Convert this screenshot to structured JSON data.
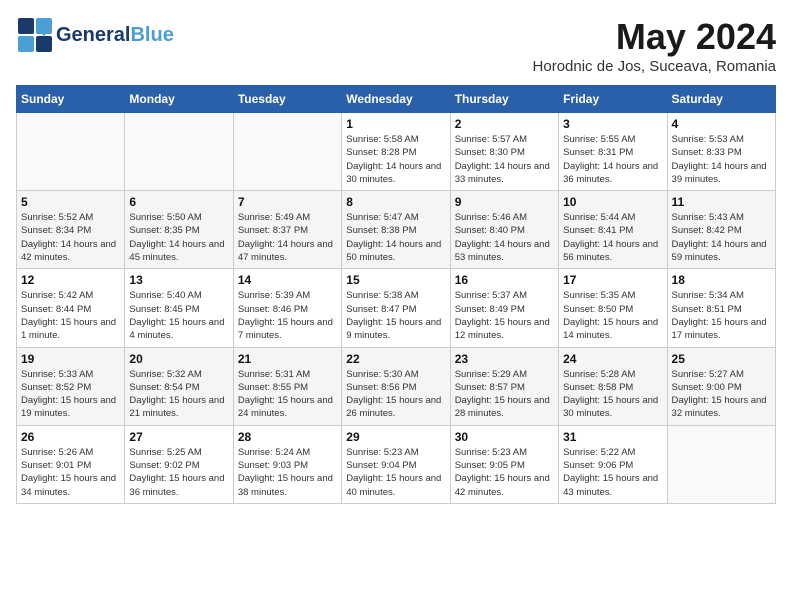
{
  "logo": {
    "part1": "General",
    "part2": "Blue"
  },
  "title": "May 2024",
  "subtitle": "Horodnic de Jos, Suceava, Romania",
  "weekdays": [
    "Sunday",
    "Monday",
    "Tuesday",
    "Wednesday",
    "Thursday",
    "Friday",
    "Saturday"
  ],
  "weeks": [
    [
      {
        "day": "",
        "info": ""
      },
      {
        "day": "",
        "info": ""
      },
      {
        "day": "",
        "info": ""
      },
      {
        "day": "1",
        "info": "Sunrise: 5:58 AM\nSunset: 8:28 PM\nDaylight: 14 hours\nand 30 minutes."
      },
      {
        "day": "2",
        "info": "Sunrise: 5:57 AM\nSunset: 8:30 PM\nDaylight: 14 hours\nand 33 minutes."
      },
      {
        "day": "3",
        "info": "Sunrise: 5:55 AM\nSunset: 8:31 PM\nDaylight: 14 hours\nand 36 minutes."
      },
      {
        "day": "4",
        "info": "Sunrise: 5:53 AM\nSunset: 8:33 PM\nDaylight: 14 hours\nand 39 minutes."
      }
    ],
    [
      {
        "day": "5",
        "info": "Sunrise: 5:52 AM\nSunset: 8:34 PM\nDaylight: 14 hours\nand 42 minutes."
      },
      {
        "day": "6",
        "info": "Sunrise: 5:50 AM\nSunset: 8:35 PM\nDaylight: 14 hours\nand 45 minutes."
      },
      {
        "day": "7",
        "info": "Sunrise: 5:49 AM\nSunset: 8:37 PM\nDaylight: 14 hours\nand 47 minutes."
      },
      {
        "day": "8",
        "info": "Sunrise: 5:47 AM\nSunset: 8:38 PM\nDaylight: 14 hours\nand 50 minutes."
      },
      {
        "day": "9",
        "info": "Sunrise: 5:46 AM\nSunset: 8:40 PM\nDaylight: 14 hours\nand 53 minutes."
      },
      {
        "day": "10",
        "info": "Sunrise: 5:44 AM\nSunset: 8:41 PM\nDaylight: 14 hours\nand 56 minutes."
      },
      {
        "day": "11",
        "info": "Sunrise: 5:43 AM\nSunset: 8:42 PM\nDaylight: 14 hours\nand 59 minutes."
      }
    ],
    [
      {
        "day": "12",
        "info": "Sunrise: 5:42 AM\nSunset: 8:44 PM\nDaylight: 15 hours\nand 1 minute."
      },
      {
        "day": "13",
        "info": "Sunrise: 5:40 AM\nSunset: 8:45 PM\nDaylight: 15 hours\nand 4 minutes."
      },
      {
        "day": "14",
        "info": "Sunrise: 5:39 AM\nSunset: 8:46 PM\nDaylight: 15 hours\nand 7 minutes."
      },
      {
        "day": "15",
        "info": "Sunrise: 5:38 AM\nSunset: 8:47 PM\nDaylight: 15 hours\nand 9 minutes."
      },
      {
        "day": "16",
        "info": "Sunrise: 5:37 AM\nSunset: 8:49 PM\nDaylight: 15 hours\nand 12 minutes."
      },
      {
        "day": "17",
        "info": "Sunrise: 5:35 AM\nSunset: 8:50 PM\nDaylight: 15 hours\nand 14 minutes."
      },
      {
        "day": "18",
        "info": "Sunrise: 5:34 AM\nSunset: 8:51 PM\nDaylight: 15 hours\nand 17 minutes."
      }
    ],
    [
      {
        "day": "19",
        "info": "Sunrise: 5:33 AM\nSunset: 8:52 PM\nDaylight: 15 hours\nand 19 minutes."
      },
      {
        "day": "20",
        "info": "Sunrise: 5:32 AM\nSunset: 8:54 PM\nDaylight: 15 hours\nand 21 minutes."
      },
      {
        "day": "21",
        "info": "Sunrise: 5:31 AM\nSunset: 8:55 PM\nDaylight: 15 hours\nand 24 minutes."
      },
      {
        "day": "22",
        "info": "Sunrise: 5:30 AM\nSunset: 8:56 PM\nDaylight: 15 hours\nand 26 minutes."
      },
      {
        "day": "23",
        "info": "Sunrise: 5:29 AM\nSunset: 8:57 PM\nDaylight: 15 hours\nand 28 minutes."
      },
      {
        "day": "24",
        "info": "Sunrise: 5:28 AM\nSunset: 8:58 PM\nDaylight: 15 hours\nand 30 minutes."
      },
      {
        "day": "25",
        "info": "Sunrise: 5:27 AM\nSunset: 9:00 PM\nDaylight: 15 hours\nand 32 minutes."
      }
    ],
    [
      {
        "day": "26",
        "info": "Sunrise: 5:26 AM\nSunset: 9:01 PM\nDaylight: 15 hours\nand 34 minutes."
      },
      {
        "day": "27",
        "info": "Sunrise: 5:25 AM\nSunset: 9:02 PM\nDaylight: 15 hours\nand 36 minutes."
      },
      {
        "day": "28",
        "info": "Sunrise: 5:24 AM\nSunset: 9:03 PM\nDaylight: 15 hours\nand 38 minutes."
      },
      {
        "day": "29",
        "info": "Sunrise: 5:23 AM\nSunset: 9:04 PM\nDaylight: 15 hours\nand 40 minutes."
      },
      {
        "day": "30",
        "info": "Sunrise: 5:23 AM\nSunset: 9:05 PM\nDaylight: 15 hours\nand 42 minutes."
      },
      {
        "day": "31",
        "info": "Sunrise: 5:22 AM\nSunset: 9:06 PM\nDaylight: 15 hours\nand 43 minutes."
      },
      {
        "day": "",
        "info": ""
      }
    ]
  ]
}
